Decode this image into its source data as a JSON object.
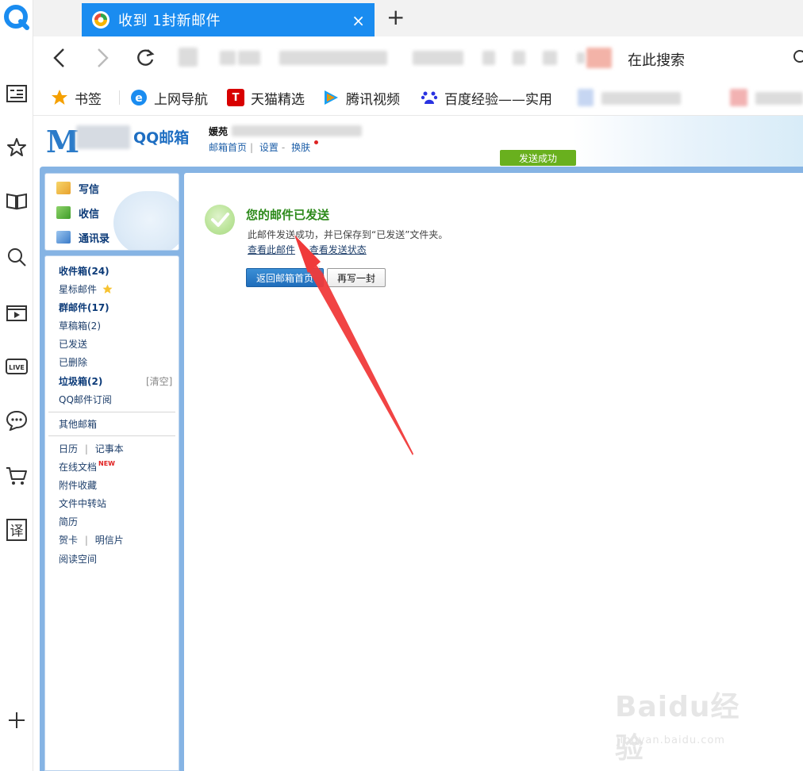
{
  "browser": {
    "tab_title": "收到 1封新邮件",
    "tab_close": "×",
    "new_tab": "+",
    "search_placeholder": "在此搜索"
  },
  "bookmarks": [
    {
      "label": "书签",
      "icon": "star-icon"
    },
    {
      "label": "上网导航",
      "icon": "ie-icon"
    },
    {
      "label": "天猫精选",
      "icon": "tmall-icon"
    },
    {
      "label": "腾讯视频",
      "icon": "tencent-video-icon"
    },
    {
      "label": "百度经验——实用",
      "icon": "baidu-icon"
    }
  ],
  "mail": {
    "logo_text": "QQ邮箱",
    "user_name": "媛苑",
    "head_links": [
      "邮箱首页",
      "设置",
      "换肤"
    ],
    "send_status": "发送成功",
    "quick_actions": [
      "写信",
      "收信",
      "通讯录"
    ],
    "folders": {
      "inbox": "收件箱(24)",
      "starred": "星标邮件",
      "group": "群邮件(17)",
      "drafts": "草稿箱(2)",
      "sent": "已发送",
      "deleted": "已删除",
      "junk": "垃圾箱(2)",
      "junk_clear": "[清空]",
      "subscribe": "QQ邮件订阅",
      "other": "其他邮箱",
      "calendar": "日历",
      "notes": "记事本",
      "docs": "在线文档",
      "docs_new": "NEW",
      "attachments": "附件收藏",
      "transfer": "文件中转站",
      "resume": "简历",
      "card": "贺卡",
      "postcard": "明信片",
      "reading": "阅读空间"
    },
    "result": {
      "title": "您的邮件已发送",
      "desc": "此邮件发送成功，并已保存到“已发送”文件夹。",
      "link_view": "查看此邮件",
      "link_status": "查看发送状态",
      "btn_home": "返回邮箱首页",
      "btn_write": "再写一封"
    }
  },
  "watermark": {
    "brand": "Baidu经验",
    "url": "jingyan.baidu.com"
  },
  "colors": {
    "tab_blue": "#1a8cf0",
    "frame_blue": "#86b4e4",
    "success_green": "#69b01e",
    "arrow_red": "#f03a3a"
  }
}
